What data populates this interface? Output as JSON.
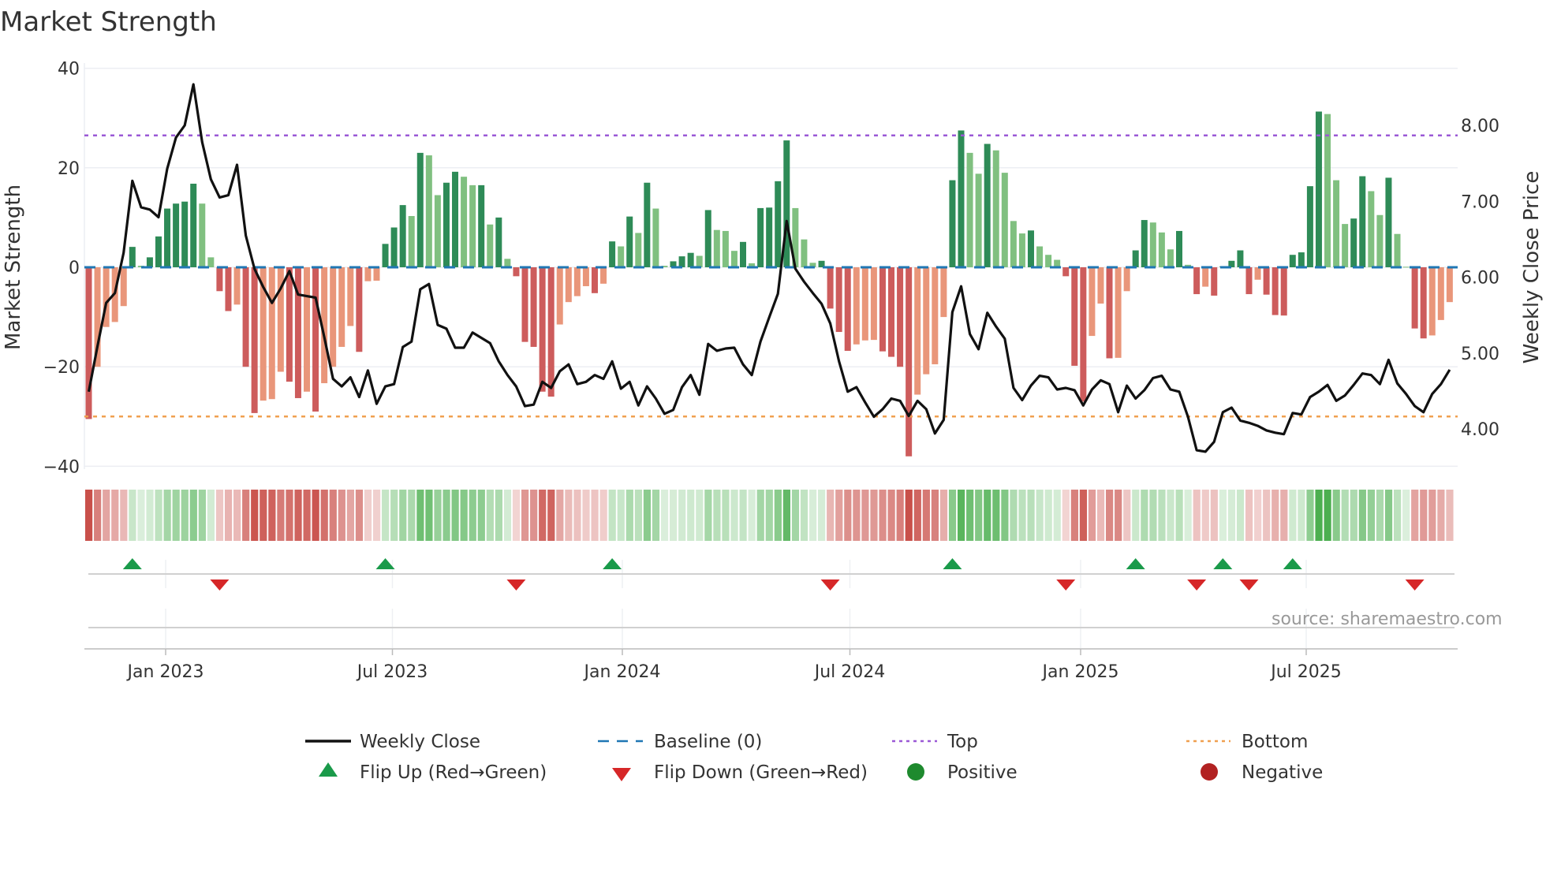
{
  "chart_data": {
    "type": "bar",
    "title": "Market Strength",
    "ylabel": "Market Strength",
    "y2label": "Weekly Close Price",
    "ylim": [
      -40,
      40
    ],
    "y2lim": [
      3.5,
      8.6
    ],
    "yticks": [
      "40",
      "20",
      "0",
      "−20",
      "−40"
    ],
    "ytick_values": [
      40,
      20,
      0,
      -20,
      -40
    ],
    "y2ticks": [
      "8.00",
      "7.00",
      "6.00",
      "5.00",
      "4.00"
    ],
    "y2tick_values": [
      8,
      7,
      6,
      5,
      4
    ],
    "xticks": [
      "Jan 2023",
      "Jul 2023",
      "Jan 2024",
      "Jul 2024",
      "Jan 2025",
      "Jul 2025"
    ],
    "top_level": 26.5,
    "bottom_level": -30,
    "baseline": 0,
    "grid": true,
    "legend_position": "bottom",
    "source": "source: sharemaestro.com",
    "colors": {
      "strong_green": "#2e8b57",
      "weak_green": "#80c080",
      "strong_red": "#cd5c5c",
      "weak_red": "#e9967a",
      "baseline": "#1f77b4",
      "top": "#9b59d6",
      "bottom": "#f0a050",
      "close": "#111111",
      "flip_up": "#1a9a4a",
      "flip_down": "#d62728",
      "heat_green": "#4caf50",
      "heat_red": "#c9504a"
    },
    "strength": [
      -30.5,
      -20,
      -12,
      -11,
      -7.8,
      4.1,
      0.3,
      2,
      6.2,
      11.8,
      12.8,
      13.2,
      16.8,
      12.8,
      2,
      -4.8,
      -8.8,
      -7.5,
      -20,
      -29.3,
      -26.8,
      -26.5,
      -21,
      -23,
      -26.3,
      -25,
      -29,
      -23.3,
      -20,
      -16,
      -11.8,
      -17,
      -2.8,
      -2.7,
      4.7,
      8,
      12.5,
      10.3,
      23,
      22.5,
      14.5,
      17,
      19.2,
      18.2,
      16.5,
      16.5,
      8.6,
      10,
      1.7,
      -1.8,
      -15,
      -16,
      -25,
      -26,
      -11.5,
      -7,
      -5.8,
      -3.8,
      -5.2,
      -3.3,
      5.2,
      4.2,
      10.2,
      6.9,
      17,
      11.8,
      0.3,
      1.2,
      2.2,
      2.9,
      2.3,
      11.5,
      7.5,
      7.3,
      3.3,
      5.1,
      0.8,
      11.9,
      12,
      17.3,
      25.5,
      11.9,
      5.6,
      0.9,
      1.3,
      -8.3,
      -13,
      -16.8,
      -15.5,
      -14.7,
      -14.6,
      -16.9,
      -18,
      -20,
      -38,
      -25.6,
      -21.5,
      -19.5,
      -10,
      17.5,
      27.5,
      23,
      18.8,
      24.8,
      23.5,
      19,
      9.3,
      6.8,
      7.4,
      4.2,
      2.5,
      1.5,
      -1.8,
      -19.8,
      -27,
      -13.8,
      -7.3,
      -18.3,
      -18.2,
      -4.8,
      3.4,
      9.5,
      9,
      7,
      3.6,
      7.3,
      0.5,
      -5.4,
      -3.9,
      -5.7,
      0.2,
      1.3,
      3.4,
      -5.4,
      -2.5,
      -5.5,
      -9.6,
      -9.7,
      2.5,
      3,
      16.3,
      31.3,
      30.8,
      17.5,
      8.7,
      9.8,
      18.3,
      15.3,
      10.5,
      18,
      6.7,
      0.1,
      -12.3,
      -14.3,
      -13.7,
      -10.6,
      -7
    ],
    "close": [
      4.49,
      5.09,
      5.66,
      5.79,
      6.32,
      7.27,
      6.92,
      6.89,
      6.79,
      7.43,
      7.84,
      8.0,
      8.54,
      7.78,
      7.29,
      7.05,
      7.08,
      7.48,
      6.55,
      6.11,
      5.87,
      5.66,
      5.85,
      6.08,
      5.77,
      5.75,
      5.73,
      5.21,
      4.66,
      4.56,
      4.68,
      4.42,
      4.77,
      4.33,
      4.56,
      4.59,
      5.08,
      5.15,
      5.84,
      5.91,
      5.37,
      5.32,
      5.07,
      5.07,
      5.27,
      5.2,
      5.13,
      4.89,
      4.71,
      4.56,
      4.3,
      4.32,
      4.62,
      4.54,
      4.76,
      4.85,
      4.59,
      4.62,
      4.71,
      4.66,
      4.89,
      4.53,
      4.62,
      4.31,
      4.56,
      4.4,
      4.2,
      4.25,
      4.55,
      4.71,
      4.45,
      5.12,
      5.03,
      5.06,
      5.07,
      4.85,
      4.71,
      5.15,
      5.47,
      5.78,
      6.74,
      6.11,
      5.94,
      5.79,
      5.65,
      5.39,
      4.89,
      4.49,
      4.55,
      4.35,
      4.16,
      4.26,
      4.4,
      4.37,
      4.17,
      4.37,
      4.26,
      3.94,
      4.12,
      5.54,
      5.88,
      5.25,
      5.05,
      5.53,
      5.35,
      5.19,
      4.54,
      4.38,
      4.57,
      4.7,
      4.68,
      4.52,
      4.54,
      4.51,
      4.31,
      4.52,
      4.64,
      4.59,
      4.22,
      4.57,
      4.4,
      4.51,
      4.67,
      4.7,
      4.52,
      4.49,
      4.16,
      3.72,
      3.7,
      3.83,
      4.22,
      4.28,
      4.11,
      4.08,
      4.04,
      3.98,
      3.95,
      3.93,
      4.21,
      4.19,
      4.42,
      4.49,
      4.58,
      4.37,
      4.44,
      4.58,
      4.73,
      4.71,
      4.59,
      4.91,
      4.6,
      4.46,
      4.3,
      4.22,
      4.46,
      4.59,
      4.78
    ]
  },
  "legend": {
    "weekly_close": "Weekly Close",
    "baseline": "Baseline (0)",
    "top": "Top",
    "bottom": "Bottom",
    "flip_up": "Flip Up (Red→Green)",
    "flip_down": "Flip Down (Green→Red)",
    "positive": "Positive",
    "negative": "Negative"
  }
}
